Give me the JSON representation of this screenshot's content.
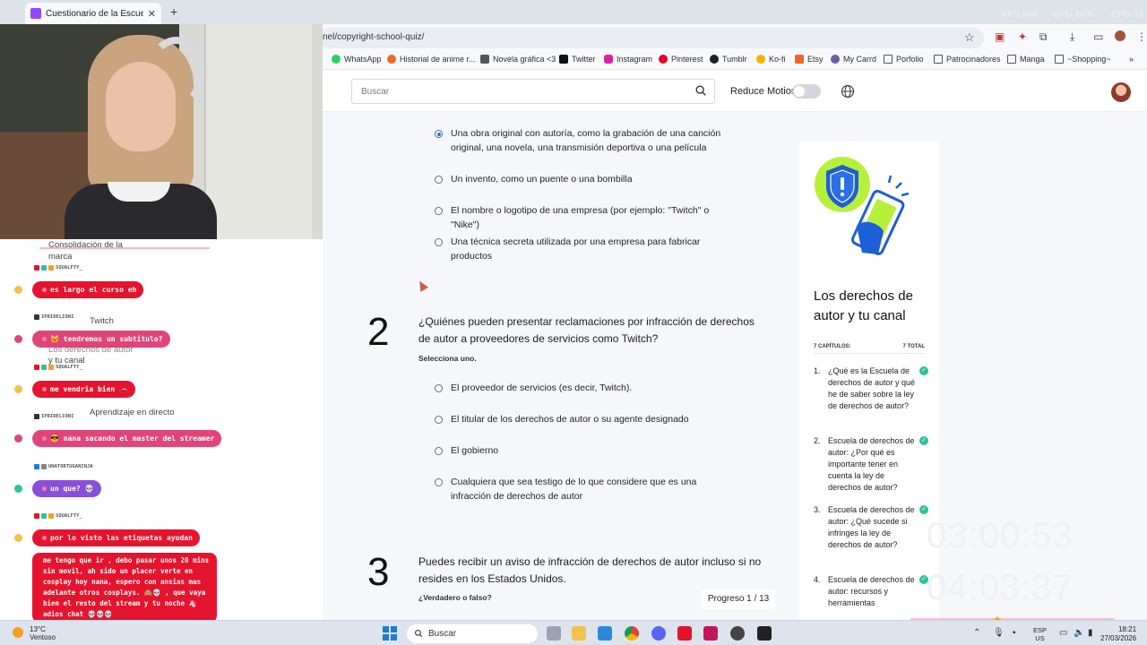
{
  "browser": {
    "tab_title": "Cuestionario de la Escuela de d",
    "url": "nel/copyright-school-quiz/",
    "overlay_stats": [
      "FPS N/A",
      "GPU 16%",
      "CPU 14"
    ],
    "bookmarks": [
      "WhatsApp",
      "Historial de anime r...",
      "Novela gráfica <3",
      "Twitter",
      "Instagram",
      "Pinterest",
      "Tumblr",
      "Ko-fi",
      "Etsy",
      "My Carrd",
      "Porfolio",
      "Patrocinadores",
      "Manga",
      "~Shopping~"
    ]
  },
  "site_header": {
    "search_placeholder": "Buscar",
    "reduce_motion_label": "Reduce Motion"
  },
  "quiz": {
    "q1_options": [
      "Una obra original con autoría, como la grabación de una canción original, una novela, una transmisión deportiva o una película",
      "Un invento, como un puente o una bombilla",
      "El nombre o logotipo de una empresa (por ejemplo: \"Twitch\" o \"Nike\")",
      "Una técnica secreta utilizada por una empresa para fabricar productos"
    ],
    "q2": {
      "number": "2",
      "text": "¿Quiénes pueden presentar reclamaciones por infracción de derechos de autor a proveedores de servicios como Twitch?",
      "hint": "Selecciona uno.",
      "options": [
        "El proveedor de servicios (es decir, Twitch).",
        "El titular de los derechos de autor o su agente designado",
        "El gobierno",
        "Cualquiera que sea testigo de lo que considere que es una infracción de derechos de autor"
      ]
    },
    "q3": {
      "number": "3",
      "text": "Puedes recibir un aviso de infracción de derechos de autor incluso si no resides en los Estados Unidos.",
      "hint": "¿Verdadero o falso?"
    },
    "progress": "Progreso 1 / 13"
  },
  "course_card": {
    "title": "Los derechos de autor y tu canal",
    "chapters_label": "7 CAPÍTULOS:",
    "total_label": "7 TOTAL",
    "chapters": [
      {
        "num": "1.",
        "text": "¿Qué es la Escuela de derechos de autor y qué he de saber sobre la ley de derechos de autor?"
      },
      {
        "num": "2.",
        "text": "Escuela de derechos de autor: ¿Por qué es importante tener en cuenta la ley de derechos de autor?"
      },
      {
        "num": "3.",
        "text": "Escuela de derechos de autor: ¿Qué sucede si infringes la ley de derechos de autor?"
      },
      {
        "num": "4.",
        "text": "Escuela de derechos de autor: recursos y herramientas"
      }
    ],
    "accent_color": "#2cc39b",
    "shield_color": "#1d5fd6",
    "lime_color": "#b7f03a"
  },
  "timers": [
    "03:00:53",
    "04:03:37"
  ],
  "chat": {
    "background_texts": [
      "Consolidación de la",
      "marca",
      "Twitch",
      "Los derechos de autor",
      "y tu canal",
      "Aprendizaje en directo"
    ],
    "messages": [
      {
        "user": "SQUALFTY_",
        "text": "es largo el curso eh",
        "style": "red"
      },
      {
        "user": "IPRIDELIONI",
        "text": "🐱 tendremos un subtitulo?",
        "style": "pink"
      },
      {
        "user": "SQUALFTY_",
        "text": "me vendria bien 🚗",
        "style": "red"
      },
      {
        "user": "IPRIDELIONI",
        "text": "😎 nana sacando el master del streamer",
        "style": "pink"
      },
      {
        "user": "UNATORTUGANINJA",
        "text": "un que? 💀",
        "style": "purple"
      },
      {
        "user": "SQUALFTY_",
        "text": "por lo visto las etiquetas ayudan",
        "style": "red"
      }
    ],
    "long_message": "me tengo que ir , debo pasar unos 20 mins sin movil, ah sido un placer verte en cosplay hoy nana, espero con ansias mas adelante otros cosplays. 🙈💀 , que vaya bien el resto del stream y tu noche 🦄 adios chat 💀💀💀"
  },
  "taskbar": {
    "temperature": "13°C",
    "weather": "Ventoso",
    "search_label": "Buscar",
    "lang_line1": "ESP",
    "lang_line2": "US",
    "time": "18:21",
    "date": "27/03/2026"
  }
}
